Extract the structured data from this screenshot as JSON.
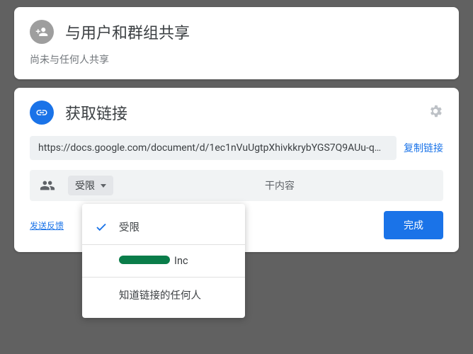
{
  "share": {
    "title": "与用户和群组共享",
    "subtitle": "尚未与任何人共享"
  },
  "link": {
    "title": "获取链接",
    "url": "https://docs.google.com/document/d/1ec1nVuUgtpXhivkkrybYGS7Q9AUu-q…",
    "copy_label": "复制链接",
    "access_label": "受限",
    "access_desc": "干内容",
    "feedback_label": "发送反馈",
    "done_label": "完成"
  },
  "dropdown": {
    "items": [
      {
        "label": "受限",
        "checked": true
      },
      {
        "label": "Inc",
        "checked": false,
        "redacted": true
      },
      {
        "label": "知道链接的任何人",
        "checked": false
      }
    ]
  }
}
